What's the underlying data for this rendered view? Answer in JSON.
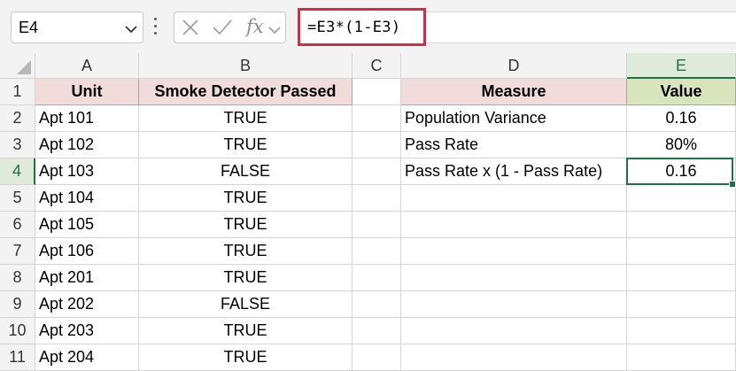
{
  "formula_bar": {
    "name_box": "E4",
    "formula": "=E3*(1-E3)",
    "fx_label": "fx"
  },
  "columns": [
    "A",
    "B",
    "C",
    "D",
    "E"
  ],
  "rows": [
    "1",
    "2",
    "3",
    "4",
    "5",
    "6",
    "7",
    "8",
    "9",
    "10",
    "11"
  ],
  "units_table": {
    "headers": [
      "Unit",
      "Smoke Detector Passed"
    ],
    "rows": [
      [
        "Apt 101",
        "TRUE"
      ],
      [
        "Apt 102",
        "TRUE"
      ],
      [
        "Apt 103",
        "FALSE"
      ],
      [
        "Apt 104",
        "TRUE"
      ],
      [
        "Apt 105",
        "TRUE"
      ],
      [
        "Apt 106",
        "TRUE"
      ],
      [
        "Apt 201",
        "TRUE"
      ],
      [
        "Apt 202",
        "FALSE"
      ],
      [
        "Apt 203",
        "TRUE"
      ],
      [
        "Apt 204",
        "TRUE"
      ]
    ]
  },
  "measures_table": {
    "headers": [
      "Measure",
      "Value"
    ],
    "rows": [
      [
        "Population Variance",
        "0.16"
      ],
      [
        "Pass Rate",
        "80%"
      ],
      [
        "Pass Rate x (1 - Pass Rate)",
        "0.16"
      ]
    ]
  },
  "selection": {
    "column": "E",
    "row": "4"
  },
  "colors": {
    "accent_green": "#1e7145",
    "highlight_red": "#d22c4b",
    "header_pink": "#f2dcdb",
    "header_green": "#d8e4bc"
  }
}
